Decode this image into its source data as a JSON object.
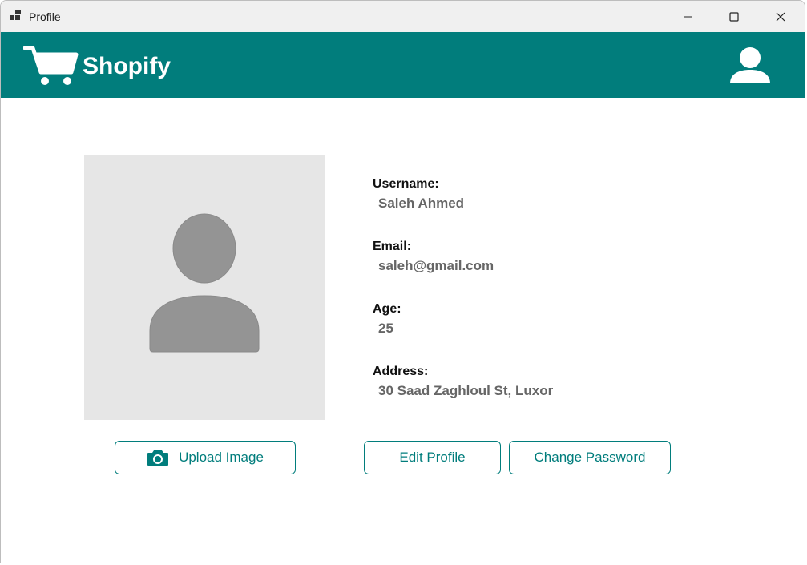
{
  "window": {
    "title": "Profile"
  },
  "header": {
    "brand": "Shopify"
  },
  "profile": {
    "fields": [
      {
        "label": "Username:",
        "value": "Saleh Ahmed"
      },
      {
        "label": "Email:",
        "value": "saleh@gmail.com"
      },
      {
        "label": "Age:",
        "value": "25"
      },
      {
        "label": "Address:",
        "value": "30 Saad Zaghloul St, Luxor"
      }
    ]
  },
  "buttons": {
    "upload": "Upload Image",
    "edit": "Edit Profile",
    "change_password": "Change Password"
  },
  "icons": {
    "app": "app-icon",
    "cart": "cart-icon",
    "user": "user-icon",
    "avatar": "avatar-placeholder-icon",
    "camera": "camera-icon"
  },
  "colors": {
    "accent": "#017d7c",
    "avatar_bg": "#e6e6e6",
    "avatar_fg": "#949494",
    "value_text": "#666666"
  }
}
